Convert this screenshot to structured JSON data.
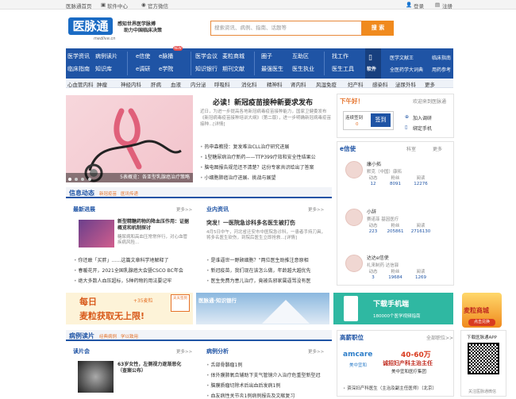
{
  "topbar": {
    "home": "医脉通首页",
    "software": "软件中心",
    "weixin": "官方微信",
    "login": "登录",
    "register": "注册"
  },
  "header": {
    "logo": "医脉通",
    "logo_url": "medlive.cn",
    "slogan_1": "感知世界医学脉搏",
    "slogan_2": "助力中国临床决策",
    "search_placeholder": "搜索资讯、病例、指南、话题等",
    "search_button": "搜 索"
  },
  "nav": {
    "col1": [
      "医学资讯",
      "临床指南"
    ],
    "col2": [
      "病例读片",
      "知识库"
    ],
    "col3": [
      "e信使",
      "e调研"
    ],
    "col4": [
      "e脉播",
      "e学院"
    ],
    "new_badge": "NEW",
    "col5": [
      "医学会议",
      "知识银行"
    ],
    "col6": [
      "麦粒商城",
      "期刊文献"
    ],
    "col7": [
      "圈子",
      "最强医生"
    ],
    "col8": [
      "互助区",
      "医生执业"
    ],
    "col9": [
      "找工作",
      "医生工具"
    ],
    "app_label": "软件",
    "col10": [
      "医学文献王",
      "全医药学大词典"
    ],
    "col11": [
      "临床指南",
      "用药参考"
    ]
  },
  "departments": [
    "心血管内科",
    "肿瘤",
    "神经内科",
    "肝病",
    "血液",
    "内分泌",
    "呼吸科",
    "消化科",
    "精神科",
    "肾内科",
    "风湿免疫",
    "妇产科",
    "感染科",
    "泌尿外科",
    "更多"
  ],
  "banner": {
    "caption": "5表概览：各亚型乳腺癌治疗策略",
    "dots": [
      "1",
      "2",
      "3",
      "4",
      "5"
    ]
  },
  "headline": {
    "title": "必读！新冠疫苗接种新要求发布",
    "desc": "近日，为进一步提高各地新冠病毒疫苗接种能力，国家卫健委发布《新冠病毒疫苗接种培训大纲》（第二版），进一步明确新冠病毒疫苗接种...[详情]",
    "items": [
      "热申森教授：复发难治CLL治疗研究进展",
      "1型糖尿病治疗新药——TTP399疗效和安全性结果公",
      "脑电图报告规范还不清楚？这份专家共识给出了答案",
      "小细胞肺癌治疗进展、挑战与展望"
    ]
  },
  "signin": {
    "title": "下午好！",
    "welcome": "欢迎来到医脉通",
    "streak_label": "连续签到",
    "streak_value": "0",
    "streak_unit": "天",
    "button": "签到",
    "join": "加入调研",
    "bind": "绑定手机"
  },
  "exin": {
    "title": "e信使",
    "filter": "科室",
    "more": "更多",
    "accounts": [
      {
        "name": "康小拓",
        "org": "默克（中国）康拓",
        "posts": "12",
        "fans": "8091",
        "reads": "12276"
      },
      {
        "name": "小辞",
        "org": "赛诺菲 基因医疗",
        "posts": "223",
        "fans": "205861",
        "reads": "2716130"
      },
      {
        "name": "达达e信使",
        "org": "礼来制药 达信驿",
        "posts": "3",
        "fans": "19684",
        "reads": "1269"
      }
    ],
    "stat_labels": [
      "动态",
      "粉丝",
      "阅读"
    ]
  },
  "info": {
    "title": "信息动态",
    "tags": [
      "新冠疫苗",
      "医讯传递"
    ],
    "latest": {
      "title": "最新进展",
      "more": "更多>>",
      "feature_title": "新型精糖药物的降血压作用：证据概览和机制探讨",
      "feature_desc": "糖尿病和高血压常常伴行，对心血管疾病风险...",
      "items": [
        "你还敢「买胖」……这篇文章科学地解释了",
        "春暖花开，2021全国乳腺癌大会暨CSCO BC年会",
        "绝大多数人血压超标，5种药物的用法要记牢"
      ]
    },
    "news": {
      "title": "业内资讯",
      "more": "更多>>",
      "feature_title": "突发！一医院急诊科多名医生被打伤",
      "feature_desc": "4月5日中午，河北省迁安市中医院急诊科，一患者手持刀具，将多名医生砍伤，到院后医生立即抢救...[详情]",
      "items": [
        "是谁逼世一野顾细胞？”两位医生助推注意原相",
        "新冠疫苗，我们现在该怎么做，年龄越大越优先",
        "医生免费为患儿治疗，竟被告邪家属逼骂没有医"
      ]
    }
  },
  "ads": {
    "ad1_line1": "每日",
    "ad1_line2": "麦粒获取无上限!",
    "ad1_badge": "+35麦粒",
    "ad1_tag": "天天签到",
    "ad2_text": "医脉通·知识银行",
    "ad3_title": "下载手机端",
    "ad3_sub": "180000个医学视频指南",
    "ad4_label": "麦粒商城",
    "ad4_button": "点击兑换"
  },
  "cases": {
    "title": "病例读片",
    "tags": [
      "经典病例",
      "学以致用"
    ],
    "reading": {
      "title": "读片会",
      "more": "更多>>",
      "feature": "63岁女性，左侧视力逐渐恶化（查案公布）"
    },
    "analysis": {
      "title": "病例分析",
      "more": "更多>>",
      "items": [
        "舌部骨骼瘤1例",
        "体外膜肺氧合辅助下支气管镜介入治疗危重型新型冠",
        "脑膜质瘤切除术后出血后发病1例",
        "血友病性关节炎1例病例报告及文献复习"
      ]
    }
  },
  "jobs": {
    "title": "高薪职位",
    "all": "全部职位>>",
    "company": "amcare",
    "company_cn": "美中宜和",
    "salary": "40-60万",
    "job_line1": "诚招妇产科主治主任",
    "job_line2": "美中宜和医疗集团",
    "item": "资深妇产科医生（主治及副主任医师）（北京）"
  },
  "app_download": {
    "title": "下载医脉通APP",
    "footer": "关注医脉通微信"
  },
  "colors": {
    "primary": "#1f54a5",
    "accent": "#f08a1e"
  }
}
